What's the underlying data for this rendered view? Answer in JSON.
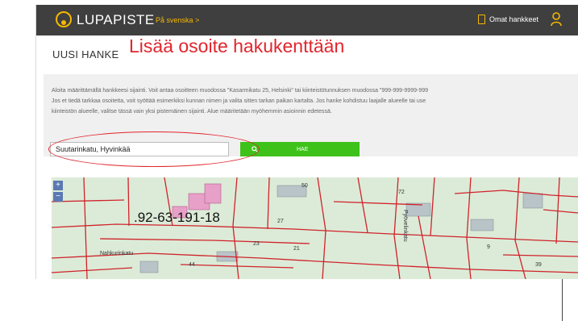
{
  "header": {
    "logo": "LUPAPISTE",
    "language_link": "På svenska >",
    "own_projects": "Omat hankkeet"
  },
  "page": {
    "title": "UUSI HANKE",
    "annotation": "Lisää osoite hakukenttään"
  },
  "info": {
    "line1": "Aloita määrittämällä hankkeesi sijainti. Voit antaa osoitteen muodossa \"Kasarmikatu 25, Helsinki\" tai kiinteistötunnuksen muodossa \"999-999-9999-999",
    "line2": "Jos et tiedä tarkkaa osoitetta, voit syöttää esimerkiksi kunnan nimen ja valita sitten tarkan paikan kartalta. Jos hanke kohdistuu laajalle alueelle tai use",
    "line3": "kiinteistön alueelle, valitse tässä vain yksi pistemäinen sijainti. Alue määritetään myöhemmin asioinnin edetessä."
  },
  "search": {
    "value": "Suutarinkatu, Hyvinkää",
    "button_label": "HAE"
  },
  "map": {
    "parcel_label": ".92-63-191-18",
    "zoom_in": "+",
    "zoom_out": "−",
    "street_labels": [
      "Nahkurinkatu",
      "Pyövelinkatu"
    ],
    "block_numbers": [
      "50",
      "72",
      "44",
      "23",
      "27",
      "21",
      "9",
      "39"
    ]
  },
  "colors": {
    "header_bg": "#3f3f3f",
    "brand_yellow": "#f5b800",
    "search_green": "#3ec21a",
    "annotation_red": "#e1252d",
    "map_bg": "#dcebd8",
    "map_lines": "#d0232a",
    "building_pink": "#e7a0c8"
  }
}
